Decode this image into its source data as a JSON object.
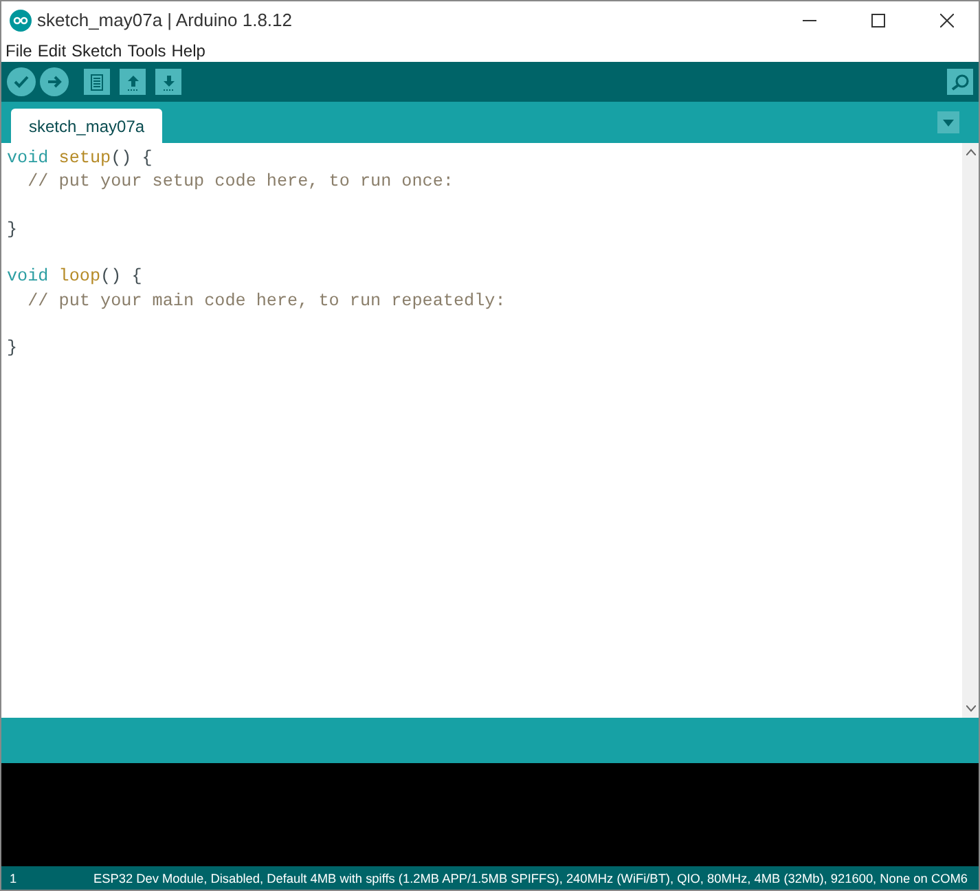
{
  "window": {
    "title": "sketch_may07a | Arduino 1.8.12"
  },
  "menu": [
    "File",
    "Edit",
    "Sketch",
    "Tools",
    "Help"
  ],
  "tabs": [
    {
      "label": "sketch_may07a",
      "selected": true
    }
  ],
  "code": [
    {
      "kind": "code",
      "segments": [
        {
          "kind": "keyword",
          "text": "void "
        },
        {
          "kind": "function",
          "text": "setup"
        },
        {
          "kind": "plain",
          "text": "() {"
        }
      ]
    },
    {
      "kind": "code",
      "segments": [
        {
          "kind": "comment",
          "text": "  // put your setup code here, to run once:"
        }
      ]
    },
    {
      "kind": "blank"
    },
    {
      "kind": "code",
      "segments": [
        {
          "kind": "plain",
          "text": "}"
        }
      ]
    },
    {
      "kind": "blank"
    },
    {
      "kind": "code",
      "segments": [
        {
          "kind": "keyword",
          "text": "void "
        },
        {
          "kind": "function",
          "text": "loop"
        },
        {
          "kind": "plain",
          "text": "() {"
        }
      ]
    },
    {
      "kind": "code",
      "segments": [
        {
          "kind": "comment",
          "text": "  // put your main code here, to run repeatedly:"
        }
      ]
    },
    {
      "kind": "blank"
    },
    {
      "kind": "code",
      "segments": [
        {
          "kind": "plain",
          "text": "}"
        }
      ]
    }
  ],
  "status_bar": {
    "line": "1",
    "board": "ESP32 Dev Module, Disabled, Default 4MB with spiffs (1.2MB APP/1.5MB SPIFFS), 240MHz (WiFi/BT), QIO, 80MHz, 4MB (32Mb), 921600, None on COM6"
  }
}
